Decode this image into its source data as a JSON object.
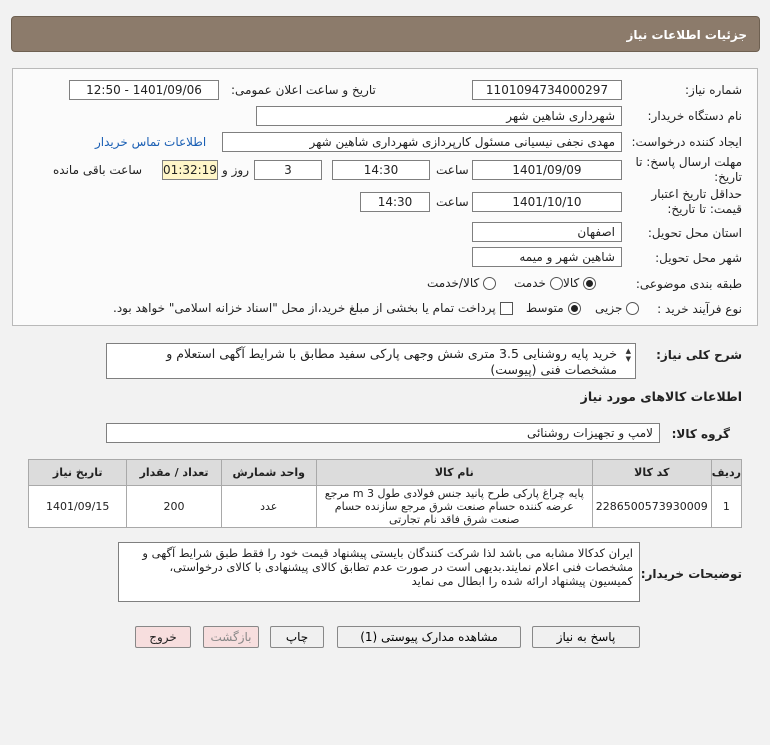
{
  "header": {
    "title": "جزئیات اطلاعات نیاز"
  },
  "form": {
    "need_number_label": "شماره نیاز:",
    "need_number": "1101094734000297",
    "announce_label": "تاریخ و ساعت اعلان عمومی:",
    "announce_value": "1401/09/06 - 12:50",
    "buyer_org_label": "نام دستگاه خریدار:",
    "buyer_org": "شهرداری شاهین شهر",
    "creator_label": "ایجاد کننده درخواست:",
    "creator": "مهدی نجفی نیسیانی مسئول کارپردازی شهرداری شاهین شهر",
    "contact_link": "اطلاعات تماس خریدار",
    "deadline_label_1": "مهلت ارسال پاسخ: تا",
    "deadline_label_2": "تاریخ:",
    "deadline_date": "1401/09/09",
    "time_label": "ساعت",
    "deadline_time": "14:30",
    "days_value": "3",
    "days_label": "روز و",
    "remaining_time": "01:32:19",
    "remaining_label": "ساعت باقی مانده",
    "validity_label_1": "حداقل تاریخ اعتبار",
    "validity_label_2": "قیمت: تا تاریخ:",
    "validity_date": "1401/10/10",
    "validity_time_label": "ساعت",
    "validity_time": "14:30",
    "province_label": "استان محل تحویل:",
    "province": "اصفهان",
    "city_label": "شهر محل تحویل:",
    "city": "شاهین شهر و میمه",
    "category_label": "طبقه بندی موضوعی:",
    "category_options": [
      "کالا",
      "خدمت",
      "کالا/خدمت"
    ],
    "process_label": "نوع فرآیند خرید :",
    "process_options": [
      "جزیی",
      "متوسط"
    ],
    "payment_note": "پرداخت تمام یا بخشی از مبلغ خرید،از محل \"اسناد خزانه اسلامی\" خواهد بود."
  },
  "summary": {
    "label": "شرح کلی نیاز:",
    "text": "خرید پایه روشنایی 3.5 متری شش وجهی پارکی سفید مطابق با شرایط آگهی استعلام و مشخصات فنی (پیوست)"
  },
  "goods_info": {
    "title": "اطلاعات کالاهای مورد نیاز",
    "group_label": "گروه کالا:",
    "group_value": "لامپ و تجهیزات روشنائی"
  },
  "table": {
    "headers": [
      "ردیف",
      "کد کالا",
      "نام کالا",
      "واحد شمارش",
      "تعداد / مقدار",
      "تاریخ نیاز"
    ],
    "rows": [
      {
        "row": "1",
        "code": "2286500573930009",
        "name": "پایه چراغ پارکی طرح پانید جنس فولادی طول m 3 مرجع عرضه کننده حسام صنعت شرق مرجع سازنده حسام صنعت شرق فاقد نام تجارتی",
        "unit": "عدد",
        "qty": "200",
        "date": "1401/09/15"
      }
    ]
  },
  "notes": {
    "label": "توضیحات خریدار:",
    "text": "ایران کدکالا مشابه می باشد لذا شرکت کنندگان بایستی پیشنهاد قیمت خود را فقط طبق شرایط آگهی و مشخصات فنی اعلام نمایند.بدیهی است در صورت عدم تطابق کالای پیشنهادی با کالای درخواستی، کمیسیون پیشنهاد ارائه شده را ابطال می نماید"
  },
  "buttons": {
    "reply": "پاسخ به نیاز",
    "attachments": "مشاهده مدارک پیوستی (1)",
    "print": "چاپ",
    "back": "بازگشت",
    "exit": "خروج"
  }
}
